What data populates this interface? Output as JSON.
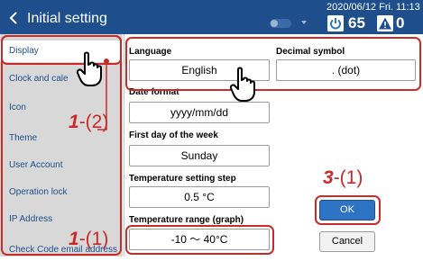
{
  "header": {
    "back_icon": "chevron-left-icon",
    "title": "Initial setting",
    "datetime": "2020/06/12 Fri. 11:13",
    "on_count": "65",
    "alert_count": "0",
    "colors": {
      "bar": "#1e4e8c",
      "power_icon": "#2f73c4",
      "alert_icon": "#1e4e8c"
    }
  },
  "sidebar": {
    "items": [
      {
        "label": "Display",
        "active": true
      },
      {
        "label": "Clock and cale"
      },
      {
        "label": "Icon"
      },
      {
        "label": "Theme"
      },
      {
        "label": "User Account"
      },
      {
        "label": "Operation lock"
      },
      {
        "label": "IP Address"
      },
      {
        "label": "Check Code email address"
      }
    ]
  },
  "form": {
    "language": {
      "label": "Language",
      "value": "English"
    },
    "decimal_symbol": {
      "label": "Decimal symbol",
      "value": ". (dot)"
    },
    "date_format": {
      "label": "Date format",
      "value": "yyyy/mm/dd"
    },
    "first_day": {
      "label": "First day of the week",
      "value": "Sunday"
    },
    "temp_step": {
      "label": "Temperature setting step",
      "value": "0.5 °C"
    },
    "temp_range": {
      "label": "Temperature range (graph)",
      "value": "-10 ～ 40°C"
    }
  },
  "buttons": {
    "ok": "OK",
    "cancel": "Cancel"
  },
  "annotations": {
    "marker_1_2": {
      "num": "1",
      "rest": "-(2)"
    },
    "marker_1_1": {
      "num": "1",
      "rest": "-(1)"
    },
    "marker_3_1": {
      "num": "3",
      "rest": "-(1)"
    },
    "color": "#c92a2a"
  }
}
